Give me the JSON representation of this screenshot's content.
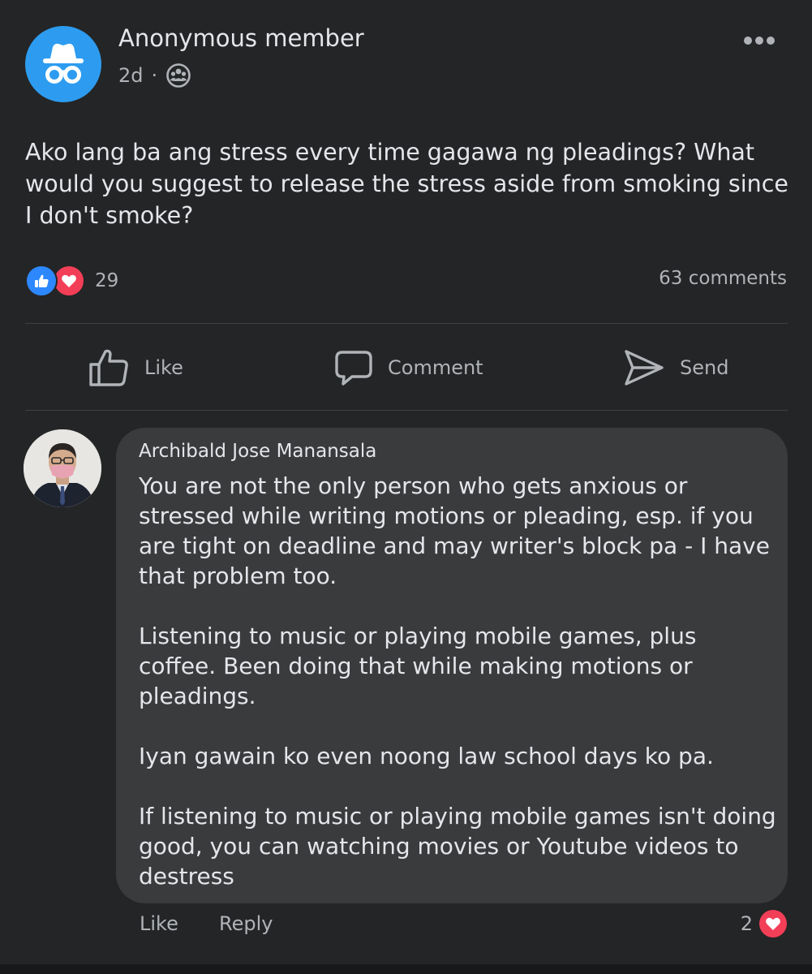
{
  "post": {
    "author": "Anonymous member",
    "time": "2d",
    "separator": "·",
    "audience_icon": "group-icon",
    "text": "Ako lang ba ang stress every time gagawa ng pleadings? What would you suggest to release the stress aside from smoking since I don't smoke?",
    "reactions": {
      "types": [
        "like",
        "love"
      ],
      "count": "29"
    },
    "comments_count": "63 comments"
  },
  "actions": {
    "like_label": "Like",
    "comment_label": "Comment",
    "send_label": "Send"
  },
  "comment": {
    "author": "Archibald Jose Manansala",
    "paragraphs": [
      "You are not the only person who gets anxious or stressed while writing motions or pleading, esp. if you are tight on deadline and may writer's block pa - I have that problem too.",
      "Listening to music or playing mobile games, plus coffee. Been doing that while making motions or pleadings.",
      "Iyan gawain ko even noong law school days ko pa.",
      "If listening to music or playing mobile games isn't doing good, you can watching movies or Youtube videos to destress"
    ],
    "like_label": "Like",
    "reply_label": "Reply",
    "reaction_count": "2",
    "reaction_type": "love"
  },
  "colors": {
    "background": "#242526",
    "bubble": "#3a3b3c",
    "text_primary": "#e4e6eb",
    "text_secondary": "#b0b3b8",
    "like_blue": "#2d88ff",
    "love_red": "#f33e58",
    "anon_avatar": "#2d9cf0"
  }
}
